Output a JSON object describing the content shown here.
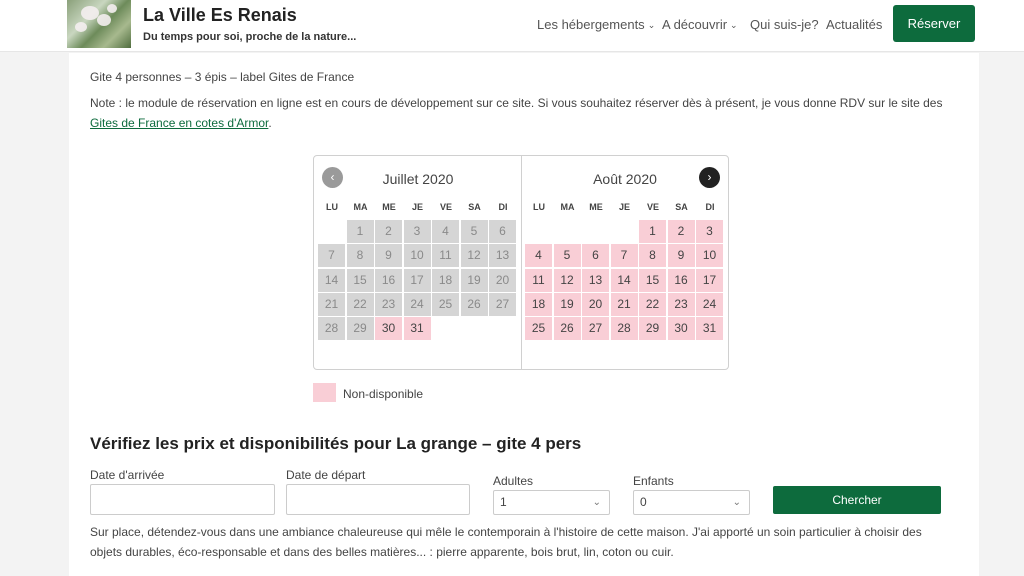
{
  "header": {
    "site_title": "La Ville Es Renais",
    "tagline": "Du temps pour soi, proche de la nature...",
    "nav": [
      {
        "label": "Les hébergements",
        "chevron": true
      },
      {
        "label": "A découvrir",
        "chevron": true
      },
      {
        "label": "Qui suis-je?",
        "chevron": false
      },
      {
        "label": "Actualités",
        "chevron": false
      }
    ],
    "reserve_label": "Réserver"
  },
  "intro": {
    "line1": "Gite 4 personnes – 3 épis – label Gites de France",
    "note": "Note : le module de réservation en ligne est en cours de développement sur ce site. Si vous souhaitez réserver dès à présent, je vous donne RDV sur le site des",
    "link": "Gites de France en cotes d'Armor",
    "link_end": "."
  },
  "calendar": {
    "prev_icon": "‹",
    "next_icon": "›",
    "weekdays": [
      "LU",
      "MA",
      "ME",
      "JE",
      "VE",
      "SA",
      "DI"
    ],
    "months": [
      {
        "title": "Juillet 2020",
        "first_weekday": 2,
        "days": 31,
        "past_until": 29,
        "unavailable": [
          30,
          31
        ]
      },
      {
        "title": "Août 2020",
        "first_weekday": 5,
        "days": 31,
        "past_until": 0,
        "unavailable": [
          1,
          2,
          3,
          4,
          5,
          6,
          7,
          8,
          9,
          10,
          11,
          12,
          13,
          14,
          15,
          16,
          17,
          18,
          19,
          20,
          21,
          22,
          23,
          24,
          25,
          26,
          27,
          28,
          29,
          30,
          31
        ]
      }
    ],
    "colors": {
      "past": "#d5d5d5",
      "unavailable": "#f9ced6"
    },
    "legend": "Non-disponible"
  },
  "search": {
    "title": "Vérifiez les prix et disponibilités pour La grange – gite 4 pers",
    "arrival_label": "Date d'arrivée",
    "departure_label": "Date de départ",
    "adults_label": "Adultes",
    "adults_value": "1",
    "children_label": "Enfants",
    "children_value": "0",
    "button": "Chercher"
  },
  "description": {
    "line1": "Sur place, détendez-vous dans une ambiance chaleureuse qui mêle le contemporain à l'histoire de cette maison. J'ai apporté un soin particulier à choisir des",
    "line2": "objets durables, éco-responsable et dans des belles matières... : pierre apparente, bois brut, lin, coton ou cuir."
  },
  "colors": {
    "brand": "#0d6b3d"
  }
}
